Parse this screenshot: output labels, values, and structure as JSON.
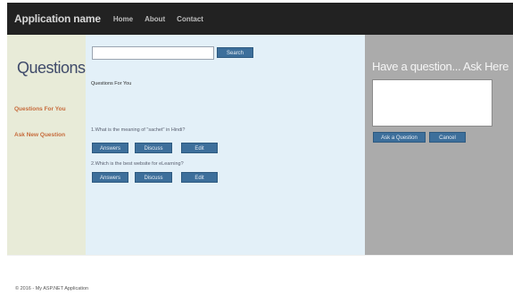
{
  "navbar": {
    "brand": "Application name",
    "links": [
      "Home",
      "About",
      "Contact"
    ]
  },
  "sidebar": {
    "title": "Questions",
    "links": [
      "Questions For You",
      "Ask New Question"
    ]
  },
  "main": {
    "search": {
      "value": "",
      "button_label": "Search"
    },
    "section_heading": "Questions For You",
    "questions": [
      {
        "text": "1.What is the meaning of \"sachet\" in Hindi?",
        "actions": [
          "Answers",
          "Discuss",
          "Edit"
        ]
      },
      {
        "text": "2.Which is the best website for eLearning?",
        "actions": [
          "Answers",
          "Discuss",
          "Edit"
        ]
      }
    ]
  },
  "ask_panel": {
    "title": "Have a question... Ask Here",
    "textarea_value": "",
    "buttons": [
      "Ask a Question",
      "Cancel"
    ]
  },
  "footer": {
    "text": "© 2016 - My ASP.NET Application"
  },
  "colors": {
    "navbar": "#222222",
    "sidebar": "#e8ebd8",
    "main": "#e3f0f8",
    "ask_panel": "#ababab",
    "button": "#3d6f9b",
    "sidebar_link": "#c66a3a"
  }
}
